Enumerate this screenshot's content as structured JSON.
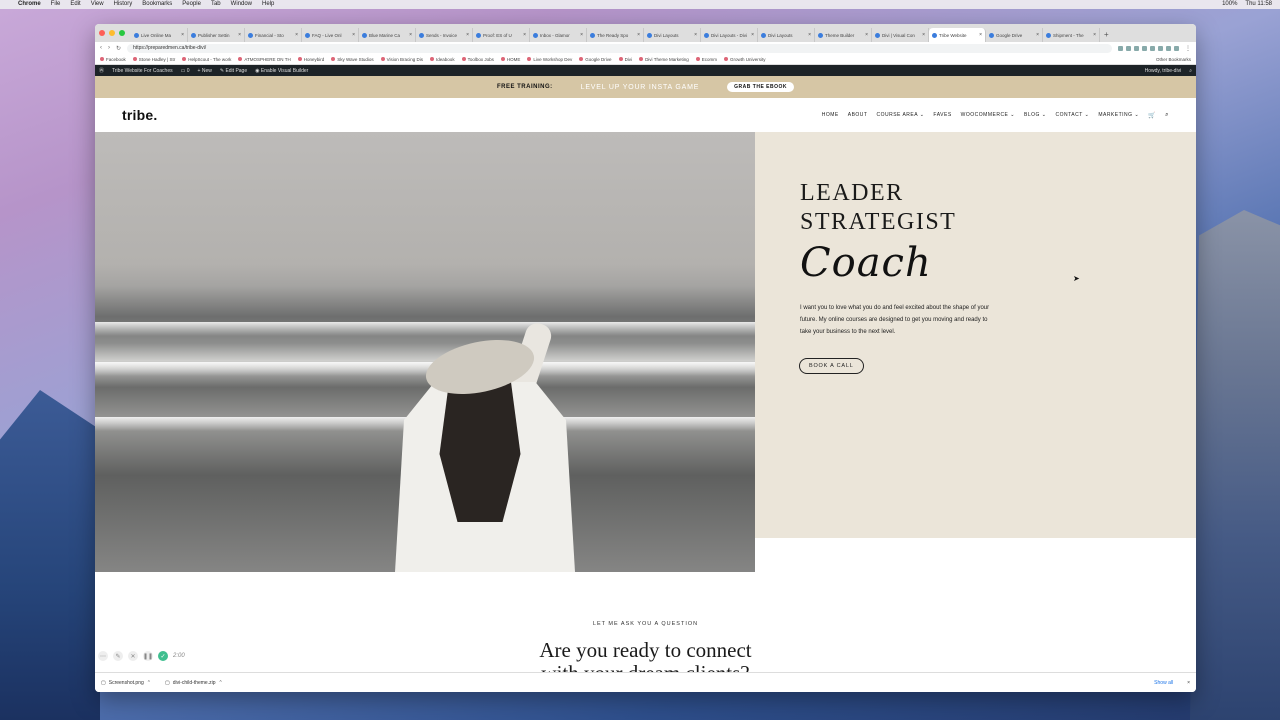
{
  "menubar": {
    "app": "Chrome",
    "items": [
      "File",
      "Edit",
      "View",
      "History",
      "Bookmarks",
      "People",
      "Tab",
      "Window",
      "Help"
    ],
    "right": [
      "100%",
      "Thu 11:58"
    ]
  },
  "browser": {
    "tabs": [
      "Live Online Ma",
      "Publisher Settin",
      "Financial - Sto",
      "FAQ - Live Onl",
      "Blue Marine Ca",
      "Sends - Invoice",
      "Proof: ES of U",
      "Inbox - Glamor",
      "The Ready Spo",
      "Divi Layouts",
      "Divi Layouts - Divi",
      "Divi Layouts",
      "Theme Builder",
      "Divi | Visual Con",
      "Tribe Website",
      "Google Drive",
      "Shipment - The"
    ],
    "active_tab_index": 14,
    "address": "https://preparedmen.ca/tribe-divi/",
    "bookmarks": [
      "Facebook",
      "Stone Hadley | Str",
      "HelpScout - The work",
      "ATMOSPHERE ON TH",
      "Honeybird",
      "Sky Wave Studios",
      "Vision Bracing Dis",
      "Ideabook",
      "Toolbox Jobs",
      "HOME",
      "Live Workshop Dev",
      "Google Drive",
      "Divi",
      "Divi Theme Marketing",
      "Ecomm",
      "Growth University"
    ],
    "other_bookmarks": "Other Bookmarks"
  },
  "wpadmin": {
    "site": "Tribe Website For Coaches",
    "comments": "0",
    "new": "New",
    "edit": "Edit Page",
    "builder": "Enable Visual Builder",
    "howdy": "Howdy, tribe-divi"
  },
  "promo": {
    "free": "FREE TRAINING:",
    "level": "LEVEL UP YOUR INSTA GAME",
    "grab": "GRAB THE EBOOK"
  },
  "site": {
    "logo": "tribe.",
    "menu": [
      "HOME",
      "ABOUT",
      "COURSE AREA",
      "FAVES",
      "WOOCOMMERCE",
      "BLOG",
      "CONTACT",
      "MARKETING"
    ]
  },
  "hero": {
    "line1": "LEADER",
    "line2": "STRATEGIST",
    "script": "Coach",
    "paragraph": "I want you to love what you do and feel excited about the shape of your future. My online courses are designed to get you moving and ready to take your business to the next level.",
    "cta": "BOOK A CALL"
  },
  "section2": {
    "kicker": "LET ME ASK YOU A QUESTION",
    "heading_line1": "Are you ready to connect",
    "heading_line2": "with your dream clients?"
  },
  "recorder": {
    "time": "2:00"
  },
  "downloads": {
    "items": [
      "Screenshot.png",
      "divi-child-theme.zip"
    ],
    "show_all": "Show all"
  },
  "colors": {
    "promo_bg": "#d6c6a5",
    "panel_bg": "#ebe5d9",
    "wp_bar": "#1d2327"
  }
}
